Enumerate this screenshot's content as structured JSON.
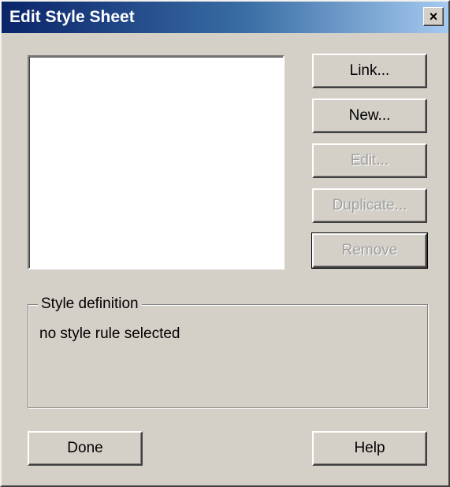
{
  "window": {
    "title": "Edit Style Sheet",
    "close_glyph": "×"
  },
  "stylesheet_list": {
    "items": []
  },
  "buttons": {
    "link": "Link...",
    "new": "New...",
    "edit": "Edit...",
    "duplicate": "Duplicate...",
    "remove": "Remove",
    "done": "Done",
    "help": "Help"
  },
  "style_definition": {
    "label": "Style definition",
    "text": "no style rule selected"
  }
}
